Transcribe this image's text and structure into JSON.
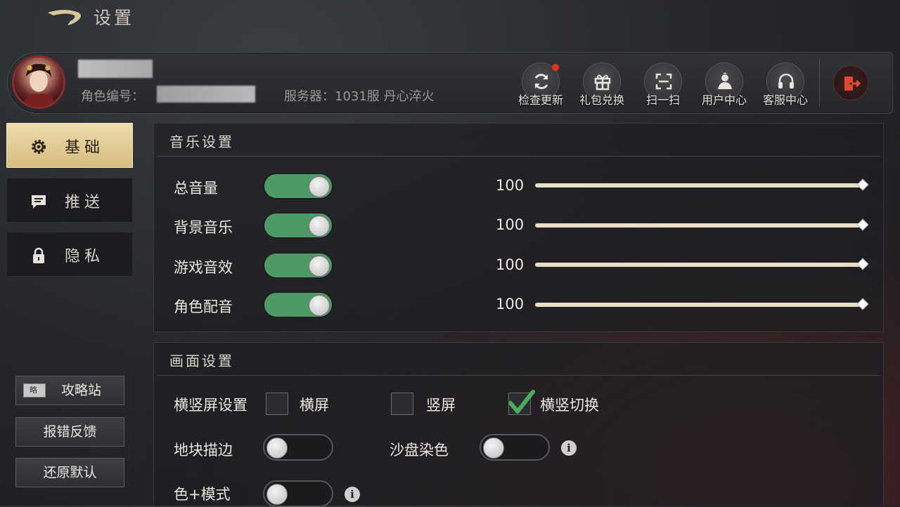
{
  "header": {
    "title": "设置"
  },
  "profile": {
    "role_id_label": "角色编号：",
    "server": "服务器：1031服 丹心淬火",
    "buttons": [
      {
        "label": "检查更新",
        "icon": "refresh-icon",
        "badge": true
      },
      {
        "label": "礼包兑换",
        "icon": "gift-icon"
      },
      {
        "label": "扫一扫",
        "icon": "scan-icon"
      },
      {
        "label": "用户中心",
        "icon": "user-icon"
      },
      {
        "label": "客服中心",
        "icon": "headset-icon"
      }
    ],
    "exit_icon": "exit-icon"
  },
  "sidebar": {
    "tabs": [
      {
        "label": "基础",
        "icon": "gear-icon",
        "active": true
      },
      {
        "label": "推送",
        "icon": "message-icon",
        "active": false
      },
      {
        "label": "隐私",
        "icon": "lock-icon",
        "active": false
      }
    ],
    "guide_button": "攻略站",
    "guide_icon_text": "略",
    "report_button": "报错反馈",
    "reset_button": "还原默认"
  },
  "music": {
    "title": "音乐设置",
    "rows": [
      {
        "label": "总音量",
        "on": true,
        "value": "100"
      },
      {
        "label": "背景音乐",
        "on": true,
        "value": "100"
      },
      {
        "label": "游戏音效",
        "on": true,
        "value": "100"
      },
      {
        "label": "角色配音",
        "on": true,
        "value": "100"
      }
    ]
  },
  "display": {
    "title": "画面设置",
    "orientation": {
      "label": "横竖屏设置",
      "options": [
        {
          "label": "横屏",
          "checked": false
        },
        {
          "label": "竖屏",
          "checked": false
        },
        {
          "label": "横竖切换",
          "checked": true
        }
      ]
    },
    "tile_outline": {
      "label": "地块描边",
      "on": false
    },
    "sandbox_color": {
      "label": "沙盘染色",
      "on": false
    },
    "color_plus": {
      "label": "色+模式",
      "on": false
    },
    "info_glyph": "i"
  },
  "colors": {
    "accent_green": "#4d9a66",
    "tab_gold": "#e3cc95",
    "badge_red": "#e0301e"
  }
}
